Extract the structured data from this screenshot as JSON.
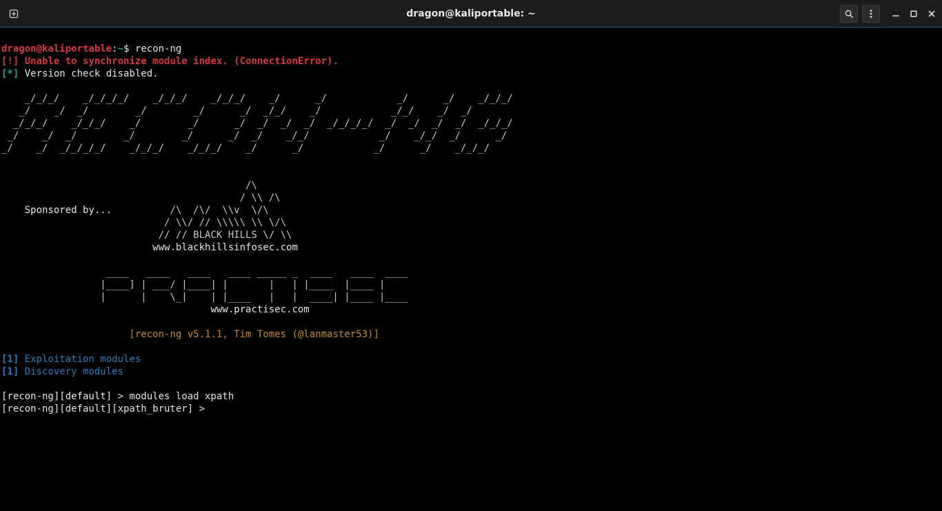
{
  "titlebar": {
    "title": "dragon@kaliportable: ~"
  },
  "prompt": {
    "user_host": "dragon@kaliportable",
    "sep": ":",
    "path": "~",
    "sym": "$",
    "command": "recon-ng"
  },
  "lines": {
    "err_tag": "[!]",
    "err_msg": " Unable to synchronize module index. (ConnectionError).",
    "info_tag": "[*]",
    "info_msg": " Version check disabled."
  },
  "ascii_main": "    _/_/_/    _/_/_/_/    _/_/_/    _/_/_/    _/      _/            _/      _/    _/_/_/\n   _/    _/  _/        _/        _/      _/  _/_/    _/            _/_/    _/  _/       \n  _/_/_/    _/_/_/    _/        _/      _/  _/  _/  _/  _/_/_/_/  _/  _/  _/  _/  _/_/_/\n _/    _/  _/        _/        _/      _/  _/    _/_/            _/    _/_/  _/      _/ \n_/    _/  _/_/_/_/    _/_/_/    _/_/_/    _/      _/            _/      _/    _/_/_/    ",
  "sponsor": {
    "label": "    Sponsored by...",
    "art": "                                          /\\\n                                         / \\\\ /\\\n                             /\\  /\\/  \\\\v  \\/\\\n                            / \\\\/ // \\\\\\\\\\ \\\\ \\/\\\n                           // // BLACK HILLS \\/ \\\\",
    "site": "www.blackhillsinfosec.com"
  },
  "practisec": {
    "art": "                  ____   ____   ____   ____ _____ _  ____   ____  ____\n                 |____] | ___/ |____| |       |   | |____  |____ |    \n                 |      |    \\_|    | |____   |   |  ____| |____ |____",
    "site": "www.practisec.com"
  },
  "versionline": "[recon-ng v5.1.1, Tim Tomes (@lanmaster53)]",
  "modules": {
    "exp_tag": "[1]",
    "exp_text": " Exploitation modules",
    "disc_tag": "[1]",
    "disc_text": " Discovery modules"
  },
  "shell": {
    "line1": "[recon-ng][default] > modules load xpath",
    "line2": "[recon-ng][default][xpath_bruter] > "
  }
}
